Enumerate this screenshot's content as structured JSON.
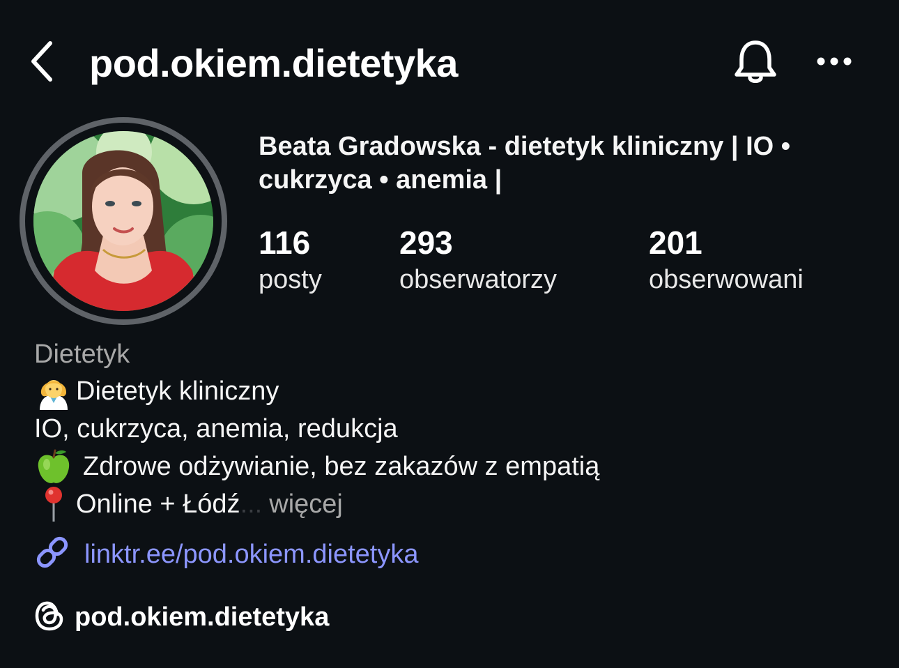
{
  "header": {
    "username": "pod.okiem.dietetyka",
    "back_icon": "chevron-left-icon",
    "bell_icon": "bell-icon",
    "more_icon": "more-horizontal-icon"
  },
  "profile": {
    "full_name": "Beata Gradowska - dietetyk kliniczny | IO • cukrzyca • anemia |",
    "avatar": "profile-photo"
  },
  "stats": [
    {
      "value": "116",
      "label": "posty"
    },
    {
      "value": "293",
      "label": "obserwatorzy"
    },
    {
      "value": "201",
      "label": "obserwowani"
    }
  ],
  "bio": {
    "category": "Dietetyk",
    "line1_icon": "woman-health-worker-emoji",
    "line1": "Dietetyk kliniczny",
    "line2": "IO, cukrzyca, anemia, redukcja",
    "line3_icon": "green-apple-emoji",
    "line3": "Zdrowe odżywianie, bez zakazów z empatią",
    "line4_icon": "round-pushpin-emoji",
    "line4": "Online + Łódź",
    "ellipsis": "...",
    "more": "więcej"
  },
  "link": {
    "icon": "link-icon",
    "text": "linktr.ee/pod.okiem.dietetyka"
  },
  "threads": {
    "icon": "threads-icon",
    "text": "pod.okiem.dietetyka"
  },
  "colors": {
    "background": "#0c1014",
    "link": "#8c96ff",
    "secondary_text": "#a8a8a8"
  }
}
